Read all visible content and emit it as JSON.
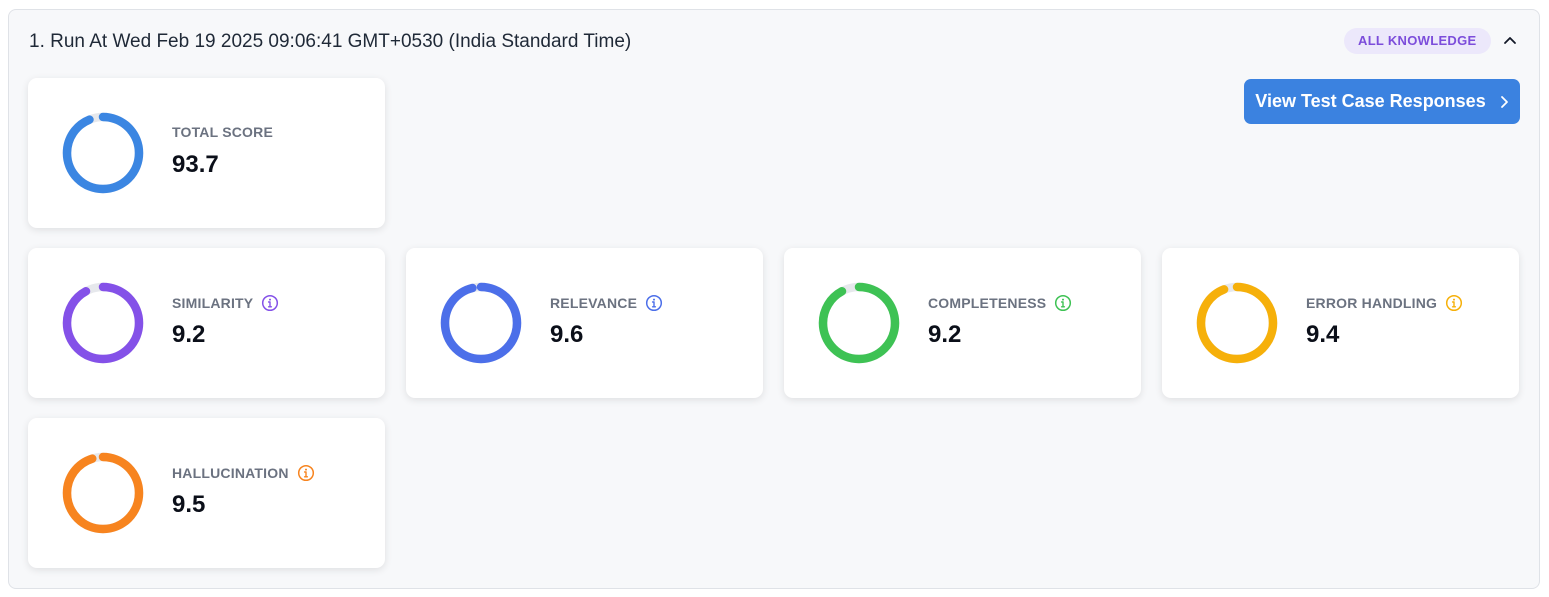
{
  "run": {
    "title": "1. Run At Wed Feb 19 2025 09:06:41 GMT+0530 (India Standard Time)",
    "tag": "ALL KNOWLEDGE",
    "collapse_icon": "chevron-up-icon",
    "view_button_label": "View Test Case Responses",
    "view_button_icon": "chevron-right-icon"
  },
  "metrics": {
    "total": {
      "label": "TOTAL SCORE",
      "value": "93.7",
      "fraction": 0.937,
      "color": "#3b86e2",
      "info": false
    },
    "similarity": {
      "label": "SIMILARITY",
      "value": "9.2",
      "fraction": 0.92,
      "color": "#8451e8",
      "info": true
    },
    "relevance": {
      "label": "RELEVANCE",
      "value": "9.6",
      "fraction": 0.96,
      "color": "#4c6fe9",
      "info": true
    },
    "completeness": {
      "label": "COMPLETENESS",
      "value": "9.2",
      "fraction": 0.92,
      "color": "#3ec254",
      "info": true
    },
    "error_handling": {
      "label": "ERROR HANDLING",
      "value": "9.4",
      "fraction": 0.94,
      "color": "#f6b00a",
      "info": true
    },
    "hallucination": {
      "label": "HALLUCINATION",
      "value": "9.5",
      "fraction": 0.95,
      "color": "#f7841f",
      "info": true
    }
  },
  "colors": {
    "track": "#e6e8ec",
    "accent_button": "#3b82e0",
    "badge_bg": "#ece8fb",
    "badge_text": "#7c4ddb"
  }
}
